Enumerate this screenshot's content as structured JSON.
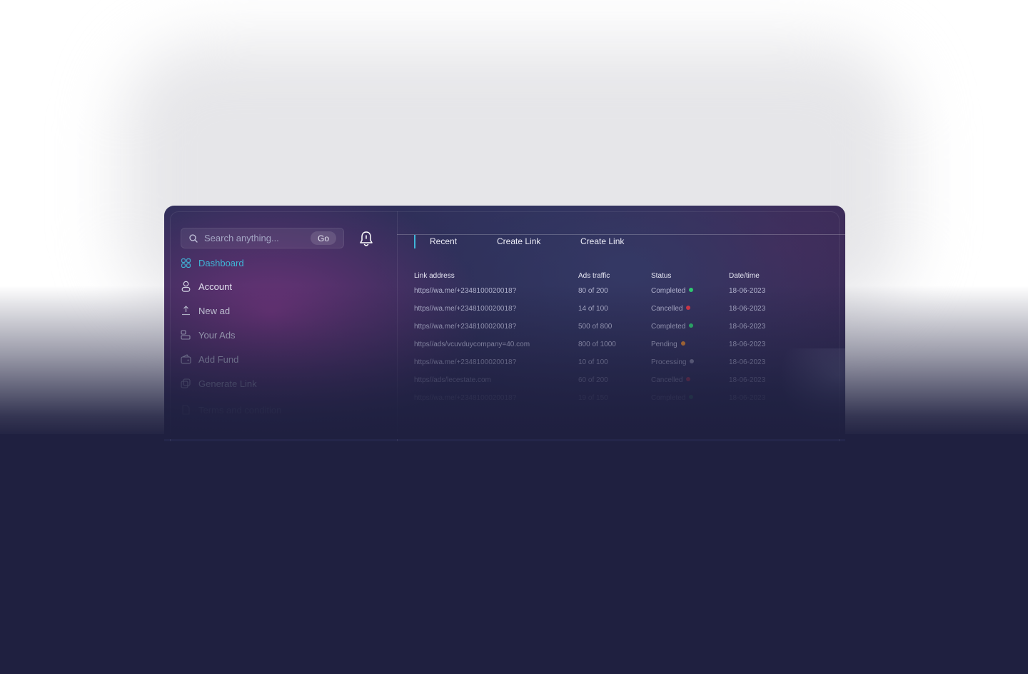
{
  "search": {
    "placeholder": "Search anything...",
    "go_label": "Go"
  },
  "sidebar": {
    "items": [
      {
        "label": "Dashboard",
        "icon": "grid-icon",
        "active": true
      },
      {
        "label": "Account",
        "icon": "user-icon"
      },
      {
        "label": "New ad",
        "icon": "upload-icon"
      },
      {
        "label": "Your Ads",
        "icon": "ads-icon"
      },
      {
        "label": "Add Fund",
        "icon": "wallet-icon"
      },
      {
        "label": "Generate Link",
        "icon": "link-copy-icon"
      },
      {
        "label": "Terms and condition",
        "icon": "document-icon"
      }
    ]
  },
  "tabs": [
    {
      "label": "Recent",
      "active": true
    },
    {
      "label": "Create Link"
    },
    {
      "label": "Create Link"
    }
  ],
  "table": {
    "headers": [
      "Link address",
      "Ads traffic",
      "Status",
      "Date/time"
    ],
    "rows": [
      {
        "link": "https//wa.me/+2348100020018?",
        "traffic": "80 of 200",
        "status": "Completed",
        "status_color": "#2ecc71",
        "date": "18-06-2023"
      },
      {
        "link": "https//wa.me/+2348100020018?",
        "traffic": "14 of 100",
        "status": "Cancelled",
        "status_color": "#e53946",
        "date": "18-06-2023"
      },
      {
        "link": "https//wa.me/+2348100020018?",
        "traffic": "500 of 800",
        "status": "Completed",
        "status_color": "#2ecc71",
        "date": "18-06-2023"
      },
      {
        "link": "https//ads/vcuvduycompany=40.com",
        "traffic": "800 of 1000",
        "status": "Pending",
        "status_color": "#e6892c",
        "date": "18-06-2023"
      },
      {
        "link": "https//wa.me/+2348100020018?",
        "traffic": "10 of 100",
        "status": "Processing",
        "status_color": "#9a9bb5",
        "date": "18-06-2023"
      },
      {
        "link": "https//ads/lecestate.com",
        "traffic": "60 of 200",
        "status": "Cancelled",
        "status_color": "#e53946",
        "date": "18-06-2023"
      },
      {
        "link": "https//wa.me/+2348100020018?",
        "traffic": "19 of 150",
        "status": "Completed",
        "status_color": "#2ecc71",
        "date": "18-06-2023"
      }
    ]
  },
  "colors": {
    "accent": "#3fb6d8",
    "background": "#1f2040"
  }
}
